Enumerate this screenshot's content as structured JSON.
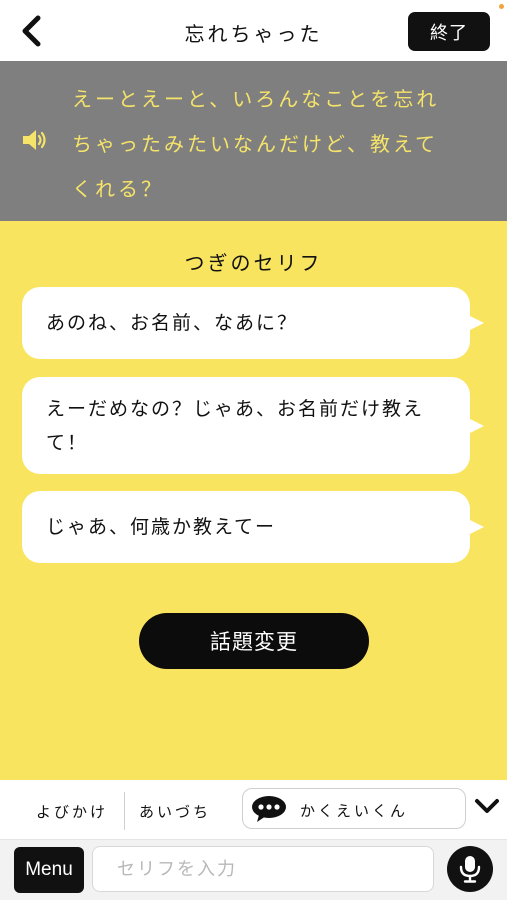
{
  "header": {
    "back_icon": "chevron-left-icon",
    "title": "忘れちゃった",
    "end_label": "終了",
    "notification_color": "#f4a23a"
  },
  "speech": {
    "speaker_icon": "speaker-icon",
    "text": "えーとえーと、いろんなことを忘れちゃったみたいなんだけど、教えてくれる？",
    "panel_color": "#7f7f7f",
    "text_color": "#f5e36a"
  },
  "next_lines": {
    "title": "つぎのセリフ",
    "items": [
      {
        "text": "あのね、お名前、なあに？"
      },
      {
        "text": "えーだめなの？じゃあ、お名前だけ教えて！"
      },
      {
        "text": "じゃあ、何歳か教えてー"
      }
    ]
  },
  "topic_change_label": "話題変更",
  "tabs": {
    "items": [
      {
        "label": "よびかけ"
      },
      {
        "label": "あいづち"
      }
    ],
    "character": {
      "icon": "chat-bubble-icon",
      "label": "かくえいくん"
    },
    "collapse_icon": "chevron-down-icon"
  },
  "input_bar": {
    "menu_label": "Menu",
    "placeholder": "セリフを入力",
    "value": "",
    "mic_icon": "microphone-icon"
  },
  "colors": {
    "background_yellow": "#f9e45f",
    "button_black": "#111111"
  }
}
